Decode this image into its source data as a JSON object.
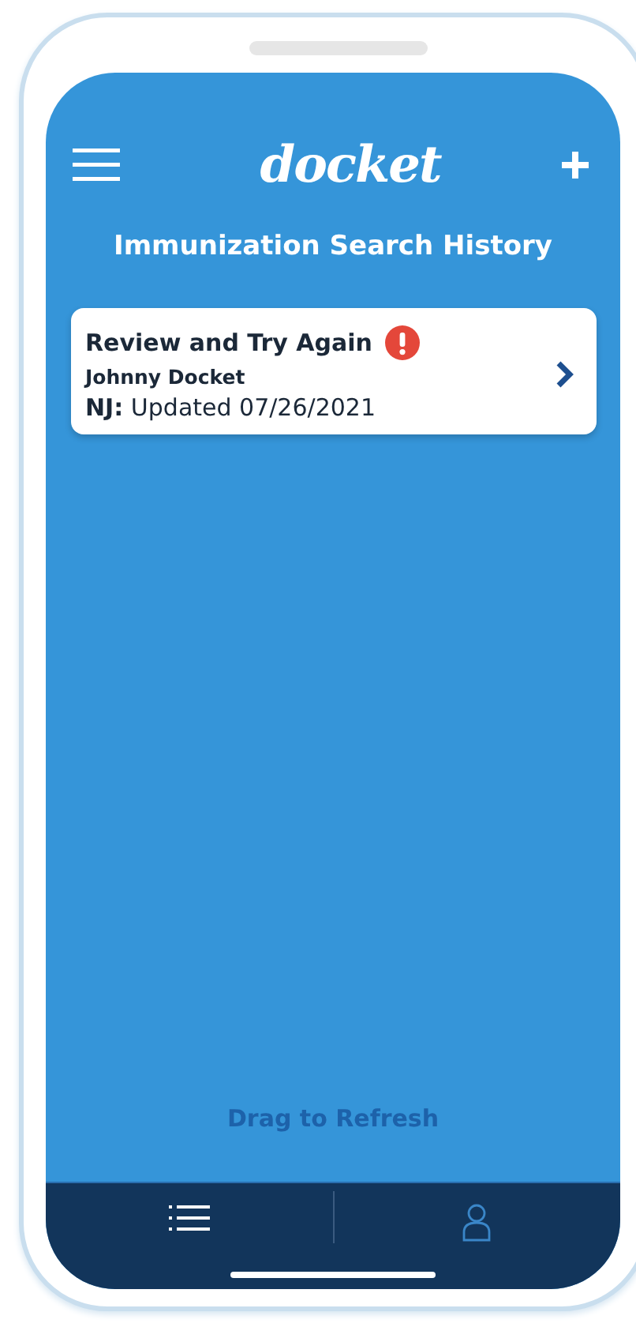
{
  "header": {
    "logo": "docket"
  },
  "title": "Immunization Search History",
  "records": [
    {
      "status": "Review and Try Again",
      "alert": true,
      "name": "Johnny Docket",
      "state": "NJ:",
      "updated": "Updated 07/26/2021"
    }
  ],
  "refresh_hint": "Drag to Refresh",
  "tab_bar": [
    {
      "kind": "list",
      "selected": true
    },
    {
      "kind": "profile",
      "selected": false
    }
  ]
}
